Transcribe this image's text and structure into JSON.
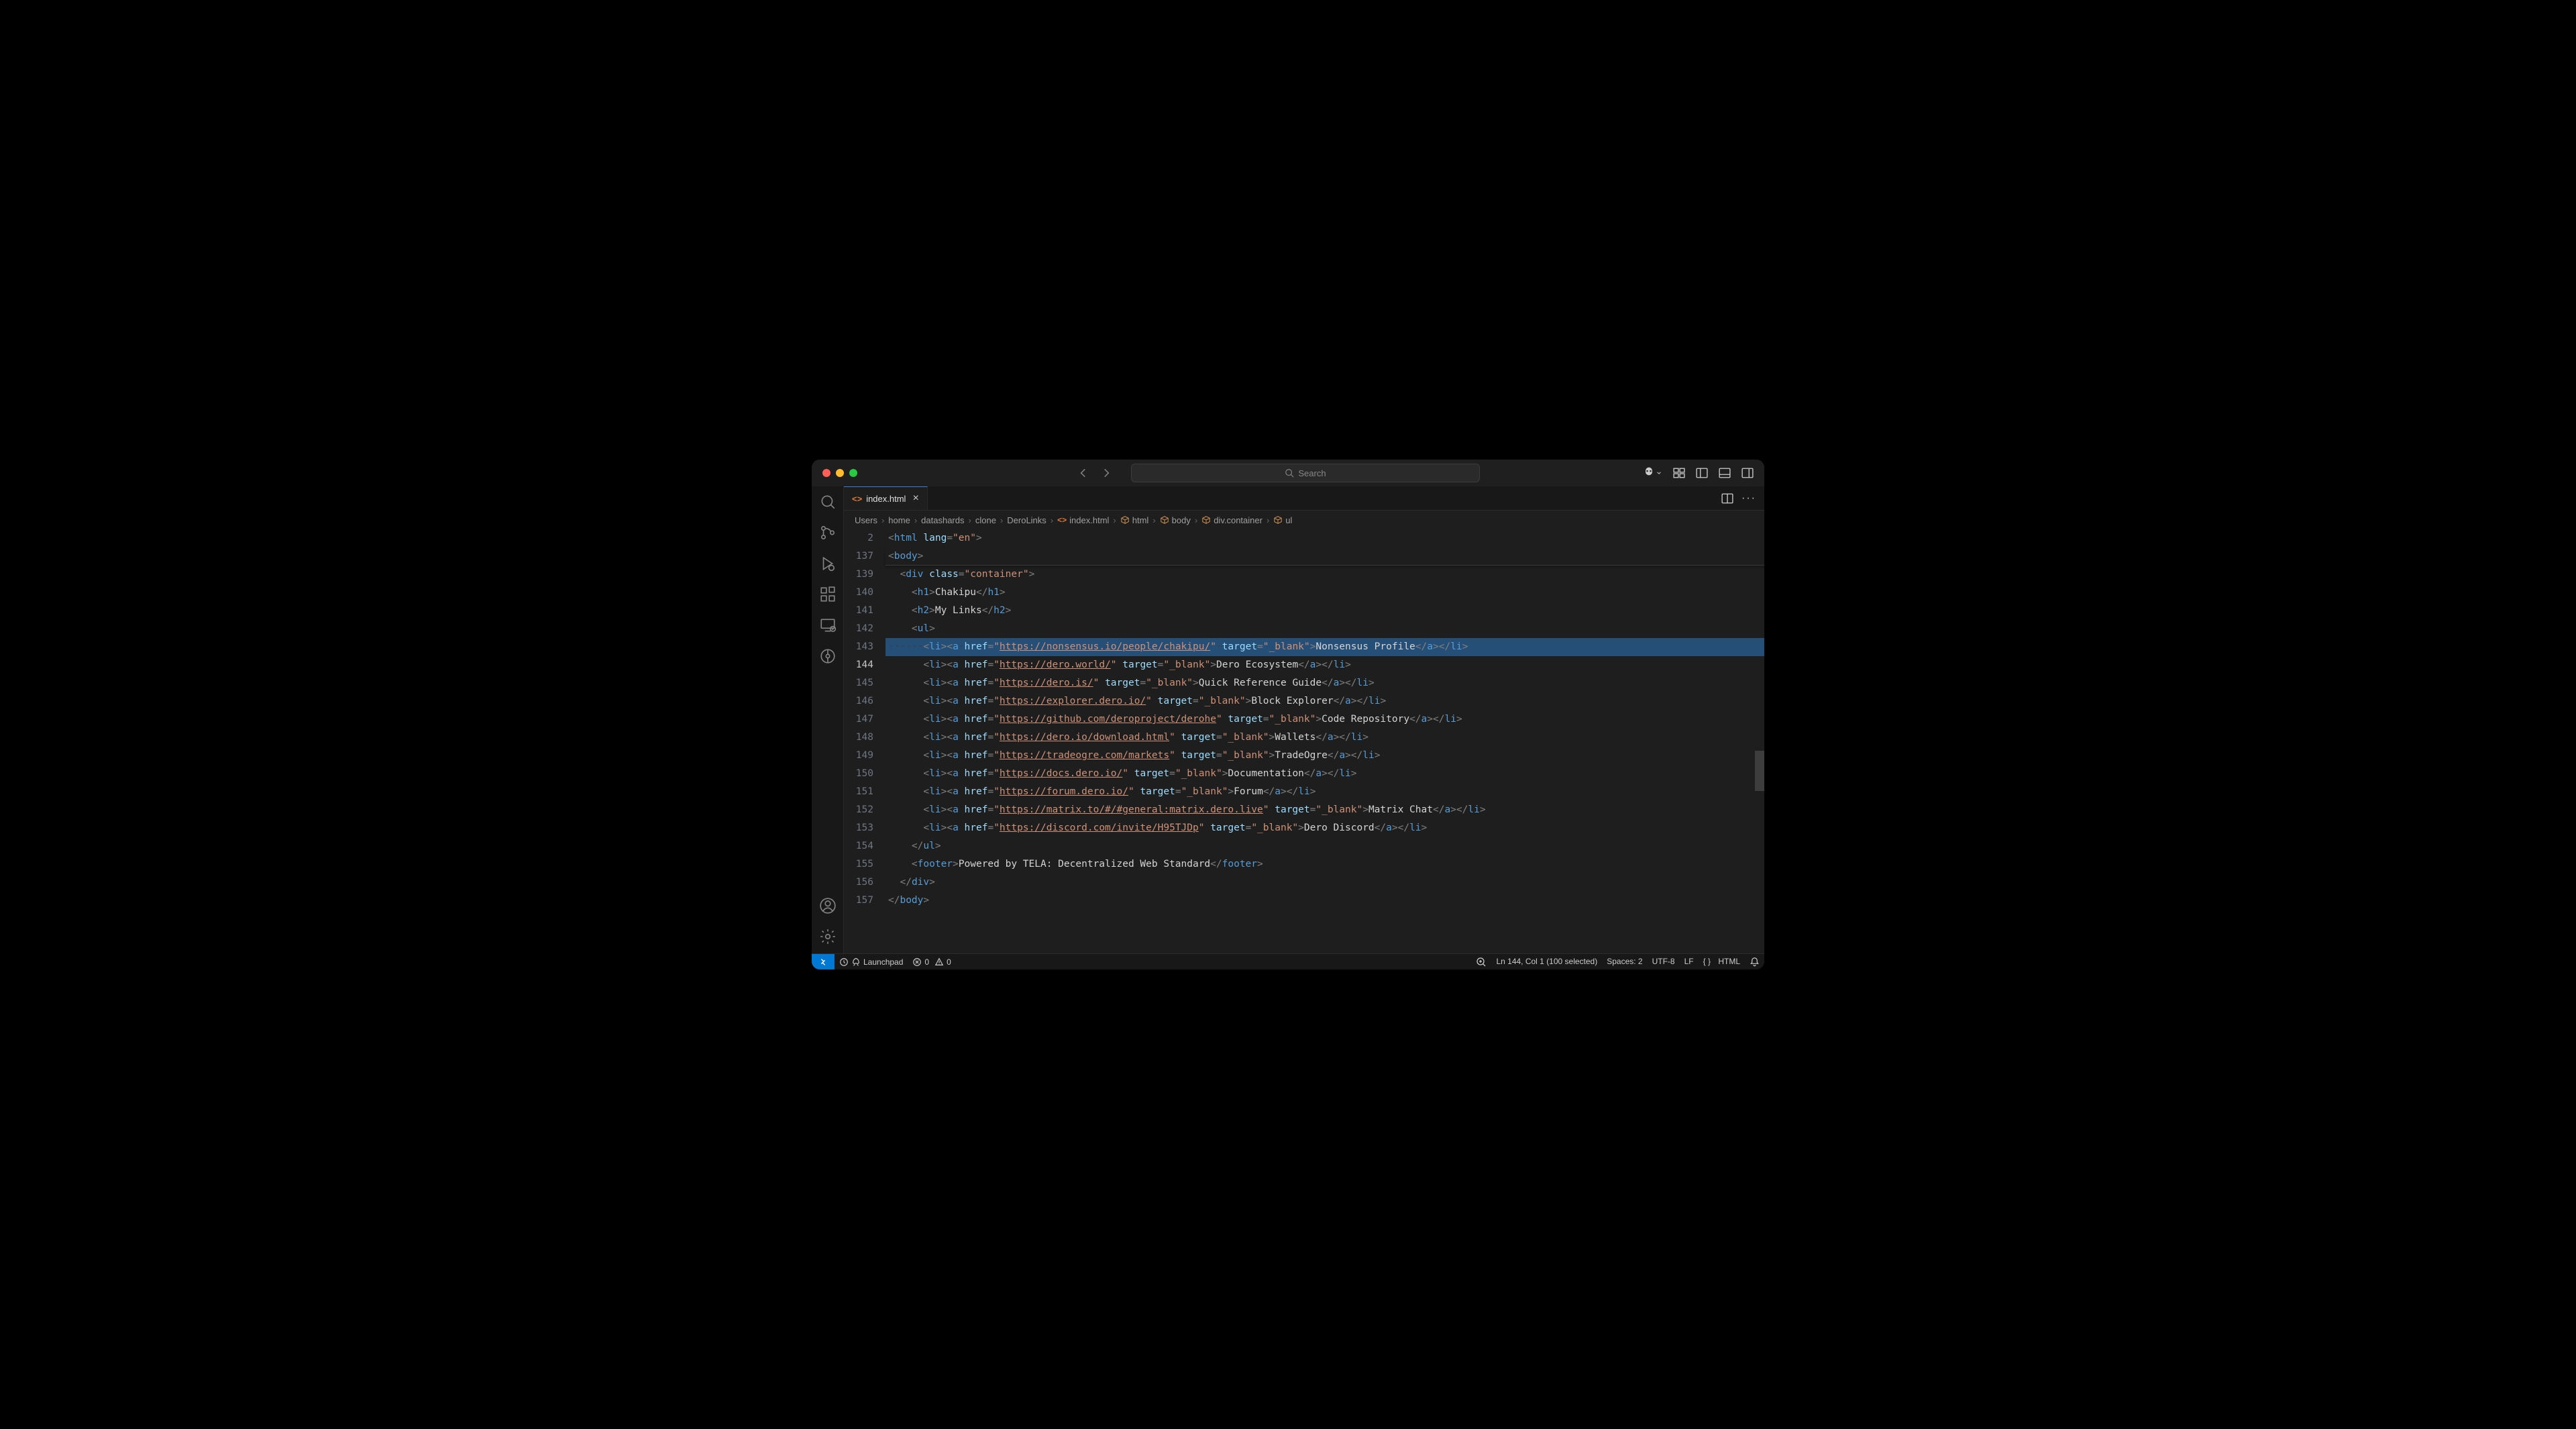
{
  "titlebar": {
    "search_placeholder": "Search"
  },
  "tab": {
    "filename": "index.html"
  },
  "breadcrumbs": [
    "Users",
    "home",
    "datashards",
    "clone",
    "DeroLinks",
    "index.html",
    "html",
    "body",
    "div.container",
    "ul"
  ],
  "gutter": {
    "sticky": [
      "2",
      "137"
    ],
    "lines": [
      "139",
      "140",
      "141",
      "142",
      "143",
      "144",
      "145",
      "146",
      "147",
      "148",
      "149",
      "150",
      "151",
      "152",
      "153",
      "154",
      "155",
      "156",
      "157"
    ],
    "current": "144"
  },
  "code": {
    "sticky": [
      {
        "indent": 0,
        "raw": "<html lang=\"en\">"
      },
      {
        "indent": 0,
        "raw": "<body>"
      }
    ],
    "lines": [
      {
        "n": "139",
        "indent": 2,
        "html": "<span class='t-br'>&lt;</span><span class='t-tag'>div</span> <span class='t-attr'>class</span><span class='t-br'>=</span><span class='t-str'>\"container\"</span><span class='t-br'>&gt;</span>"
      },
      {
        "n": "140",
        "indent": 4,
        "html": "<span class='t-br'>&lt;</span><span class='t-tag'>h1</span><span class='t-br'>&gt;</span><span class='t-txt'>Chakipu</span><span class='t-br'>&lt;/</span><span class='t-tag'>h1</span><span class='t-br'>&gt;</span>"
      },
      {
        "n": "141",
        "indent": 4,
        "html": "<span class='t-br'>&lt;</span><span class='t-tag'>h2</span><span class='t-br'>&gt;</span><span class='t-txt'>My Links</span><span class='t-br'>&lt;/</span><span class='t-tag'>h2</span><span class='t-br'>&gt;</span>"
      },
      {
        "n": "142",
        "indent": 4,
        "html": "<span class='t-br'>&lt;</span><span class='t-tag'>ul</span><span class='t-br'>&gt;</span>"
      },
      {
        "n": "143",
        "indent": 6,
        "selected": true,
        "ws": "······",
        "html": "<span class='t-br'>&lt;</span><span class='t-tag'>li</span><span class='t-br'>&gt;&lt;</span><span class='t-tag'>a</span><span class='t-ws'>·</span><span class='t-attr'>href</span><span class='t-br'>=</span><span class='t-str'>\"</span><span class='t-link'>https://nonsensus.io/people/chakipu/</span><span class='t-str'>\"</span><span class='t-ws'>·</span><span class='t-attr'>target</span><span class='t-br'>=</span><span class='t-str'>\"_blank\"</span><span class='t-br'>&gt;</span><span class='t-txt'>Nonsensus Profile</span><span class='t-br'>&lt;/</span><span class='t-tag'>a</span><span class='t-br'>&gt;&lt;/</span><span class='t-tag'>li</span><span class='t-br'>&gt;</span>"
      },
      {
        "n": "144",
        "indent": 6,
        "html": "<span class='t-br'>&lt;</span><span class='t-tag'>li</span><span class='t-br'>&gt;&lt;</span><span class='t-tag'>a</span> <span class='t-attr'>href</span><span class='t-br'>=</span><span class='t-str'>\"</span><span class='t-link'>https://dero.world/</span><span class='t-str'>\"</span> <span class='t-attr'>target</span><span class='t-br'>=</span><span class='t-str'>\"_blank\"</span><span class='t-br'>&gt;</span><span class='t-txt'>Dero Ecosystem</span><span class='t-br'>&lt;/</span><span class='t-tag'>a</span><span class='t-br'>&gt;&lt;/</span><span class='t-tag'>li</span><span class='t-br'>&gt;</span>"
      },
      {
        "n": "145",
        "indent": 6,
        "html": "<span class='t-br'>&lt;</span><span class='t-tag'>li</span><span class='t-br'>&gt;&lt;</span><span class='t-tag'>a</span> <span class='t-attr'>href</span><span class='t-br'>=</span><span class='t-str'>\"</span><span class='t-link'>https://dero.is/</span><span class='t-str'>\"</span> <span class='t-attr'>target</span><span class='t-br'>=</span><span class='t-str'>\"_blank\"</span><span class='t-br'>&gt;</span><span class='t-txt'>Quick Reference Guide</span><span class='t-br'>&lt;/</span><span class='t-tag'>a</span><span class='t-br'>&gt;&lt;/</span><span class='t-tag'>li</span><span class='t-br'>&gt;</span>"
      },
      {
        "n": "146",
        "indent": 6,
        "html": "<span class='t-br'>&lt;</span><span class='t-tag'>li</span><span class='t-br'>&gt;&lt;</span><span class='t-tag'>a</span> <span class='t-attr'>href</span><span class='t-br'>=</span><span class='t-str'>\"</span><span class='t-link'>https://explorer.dero.io/</span><span class='t-str'>\"</span> <span class='t-attr'>target</span><span class='t-br'>=</span><span class='t-str'>\"_blank\"</span><span class='t-br'>&gt;</span><span class='t-txt'>Block Explorer</span><span class='t-br'>&lt;/</span><span class='t-tag'>a</span><span class='t-br'>&gt;&lt;/</span><span class='t-tag'>li</span><span class='t-br'>&gt;</span>"
      },
      {
        "n": "147",
        "indent": 6,
        "html": "<span class='t-br'>&lt;</span><span class='t-tag'>li</span><span class='t-br'>&gt;&lt;</span><span class='t-tag'>a</span> <span class='t-attr'>href</span><span class='t-br'>=</span><span class='t-str'>\"</span><span class='t-link'>https://github.com/deroproject/derohe</span><span class='t-str'>\"</span> <span class='t-attr'>target</span><span class='t-br'>=</span><span class='t-str'>\"_blank\"</span><span class='t-br'>&gt;</span><span class='t-txt'>Code Repository</span><span class='t-br'>&lt;/</span><span class='t-tag'>a</span><span class='t-br'>&gt;&lt;/</span><span class='t-tag'>li</span><span class='t-br'>&gt;</span>"
      },
      {
        "n": "148",
        "indent": 6,
        "html": "<span class='t-br'>&lt;</span><span class='t-tag'>li</span><span class='t-br'>&gt;&lt;</span><span class='t-tag'>a</span> <span class='t-attr'>href</span><span class='t-br'>=</span><span class='t-str'>\"</span><span class='t-link'>https://dero.io/download.html</span><span class='t-str'>\"</span> <span class='t-attr'>target</span><span class='t-br'>=</span><span class='t-str'>\"_blank\"</span><span class='t-br'>&gt;</span><span class='t-txt'>Wallets</span><span class='t-br'>&lt;/</span><span class='t-tag'>a</span><span class='t-br'>&gt;&lt;/</span><span class='t-tag'>li</span><span class='t-br'>&gt;</span>"
      },
      {
        "n": "149",
        "indent": 6,
        "html": "<span class='t-br'>&lt;</span><span class='t-tag'>li</span><span class='t-br'>&gt;&lt;</span><span class='t-tag'>a</span> <span class='t-attr'>href</span><span class='t-br'>=</span><span class='t-str'>\"</span><span class='t-link'>https://tradeogre.com/markets</span><span class='t-str'>\"</span> <span class='t-attr'>target</span><span class='t-br'>=</span><span class='t-str'>\"_blank\"</span><span class='t-br'>&gt;</span><span class='t-txt'>TradeOgre</span><span class='t-br'>&lt;/</span><span class='t-tag'>a</span><span class='t-br'>&gt;&lt;/</span><span class='t-tag'>li</span><span class='t-br'>&gt;</span>"
      },
      {
        "n": "150",
        "indent": 6,
        "html": "<span class='t-br'>&lt;</span><span class='t-tag'>li</span><span class='t-br'>&gt;&lt;</span><span class='t-tag'>a</span> <span class='t-attr'>href</span><span class='t-br'>=</span><span class='t-str'>\"</span><span class='t-link'>https://docs.dero.io/</span><span class='t-str'>\"</span> <span class='t-attr'>target</span><span class='t-br'>=</span><span class='t-str'>\"_blank\"</span><span class='t-br'>&gt;</span><span class='t-txt'>Documentation</span><span class='t-br'>&lt;/</span><span class='t-tag'>a</span><span class='t-br'>&gt;&lt;/</span><span class='t-tag'>li</span><span class='t-br'>&gt;</span>"
      },
      {
        "n": "151",
        "indent": 6,
        "html": "<span class='t-br'>&lt;</span><span class='t-tag'>li</span><span class='t-br'>&gt;&lt;</span><span class='t-tag'>a</span> <span class='t-attr'>href</span><span class='t-br'>=</span><span class='t-str'>\"</span><span class='t-link'>https://forum.dero.io/</span><span class='t-str'>\"</span> <span class='t-attr'>target</span><span class='t-br'>=</span><span class='t-str'>\"_blank\"</span><span class='t-br'>&gt;</span><span class='t-txt'>Forum</span><span class='t-br'>&lt;/</span><span class='t-tag'>a</span><span class='t-br'>&gt;&lt;/</span><span class='t-tag'>li</span><span class='t-br'>&gt;</span>"
      },
      {
        "n": "152",
        "indent": 6,
        "html": "<span class='t-br'>&lt;</span><span class='t-tag'>li</span><span class='t-br'>&gt;&lt;</span><span class='t-tag'>a</span> <span class='t-attr'>href</span><span class='t-br'>=</span><span class='t-str'>\"</span><span class='t-link'>https://matrix.to/#/#general:matrix.dero.live</span><span class='t-str'>\"</span> <span class='t-attr'>target</span><span class='t-br'>=</span><span class='t-str'>\"_blank\"</span><span class='t-br'>&gt;</span><span class='t-txt'>Matrix Chat</span><span class='t-br'>&lt;/</span><span class='t-tag'>a</span><span class='t-br'>&gt;&lt;/</span><span class='t-tag'>li</span><span class='t-br'>&gt;</span>"
      },
      {
        "n": "153",
        "indent": 6,
        "html": "<span class='t-br'>&lt;</span><span class='t-tag'>li</span><span class='t-br'>&gt;&lt;</span><span class='t-tag'>a</span> <span class='t-attr'>href</span><span class='t-br'>=</span><span class='t-str'>\"</span><span class='t-link'>https://discord.com/invite/H95TJDp</span><span class='t-str'>\"</span> <span class='t-attr'>target</span><span class='t-br'>=</span><span class='t-str'>\"_blank\"</span><span class='t-br'>&gt;</span><span class='t-txt'>Dero Discord</span><span class='t-br'>&lt;/</span><span class='t-tag'>a</span><span class='t-br'>&gt;&lt;/</span><span class='t-tag'>li</span><span class='t-br'>&gt;</span>"
      },
      {
        "n": "154",
        "indent": 4,
        "html": "<span class='t-br'>&lt;/</span><span class='t-tag'>ul</span><span class='t-br'>&gt;</span>"
      },
      {
        "n": "155",
        "indent": 4,
        "html": "<span class='t-br'>&lt;</span><span class='t-tag'>footer</span><span class='t-br'>&gt;</span><span class='t-txt'>Powered by TELA: Decentralized Web Standard</span><span class='t-br'>&lt;/</span><span class='t-tag'>footer</span><span class='t-br'>&gt;</span>"
      },
      {
        "n": "156",
        "indent": 2,
        "html": "<span class='t-br'>&lt;/</span><span class='t-tag'>div</span><span class='t-br'>&gt;</span>"
      },
      {
        "n": "157",
        "indent": 0,
        "html": "<span class='t-br'>&lt;/</span><span class='t-tag'>body</span><span class='t-br'>&gt;</span>"
      }
    ]
  },
  "statusbar": {
    "launchpad": "Launchpad",
    "errors": "0",
    "warnings": "0",
    "position": "Ln 144, Col 1 (100 selected)",
    "spaces": "Spaces: 2",
    "encoding": "UTF-8",
    "eol": "LF",
    "language": "HTML"
  }
}
